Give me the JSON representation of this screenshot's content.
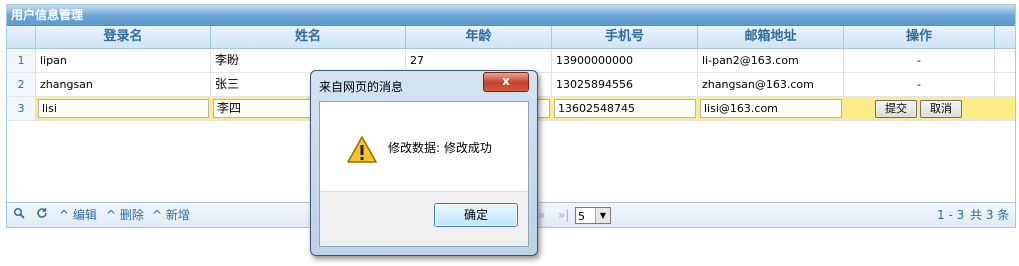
{
  "grid": {
    "caption": "用户信息管理",
    "columns": [
      "登录名",
      "姓名",
      "年龄",
      "手机号",
      "邮箱地址",
      "操作"
    ],
    "rows": [
      {
        "num": "1",
        "login": "lipan",
        "name": "李盼",
        "age": "27",
        "phone": "13900000000",
        "email": "li-pan2@163.com",
        "action": "-"
      },
      {
        "num": "2",
        "login": "zhangsan",
        "name": "张三",
        "age": "",
        "phone": "13025894556",
        "email": "zhangsan@163.com",
        "action": "-"
      },
      {
        "num": "3",
        "login": "lisi",
        "name": "李四",
        "age": "",
        "phone": "13602548745",
        "email": "lisi@163.com",
        "action": ""
      }
    ],
    "edit_actions": {
      "submit": "提交",
      "cancel": "取消"
    }
  },
  "pager": {
    "edit": "编辑",
    "delete": "删除",
    "add": "新增",
    "rows_per_page": "5",
    "range": "1 - 3",
    "total": "共 3 条"
  },
  "dialog": {
    "title": "来自网页的消息",
    "close": "x",
    "message": "修改数据: 修改成功",
    "ok": "确定"
  },
  "colors": {
    "header_text": "#2e6e9e",
    "caption_bg": "#5c9ccc",
    "selected_row": "#fbec88"
  }
}
